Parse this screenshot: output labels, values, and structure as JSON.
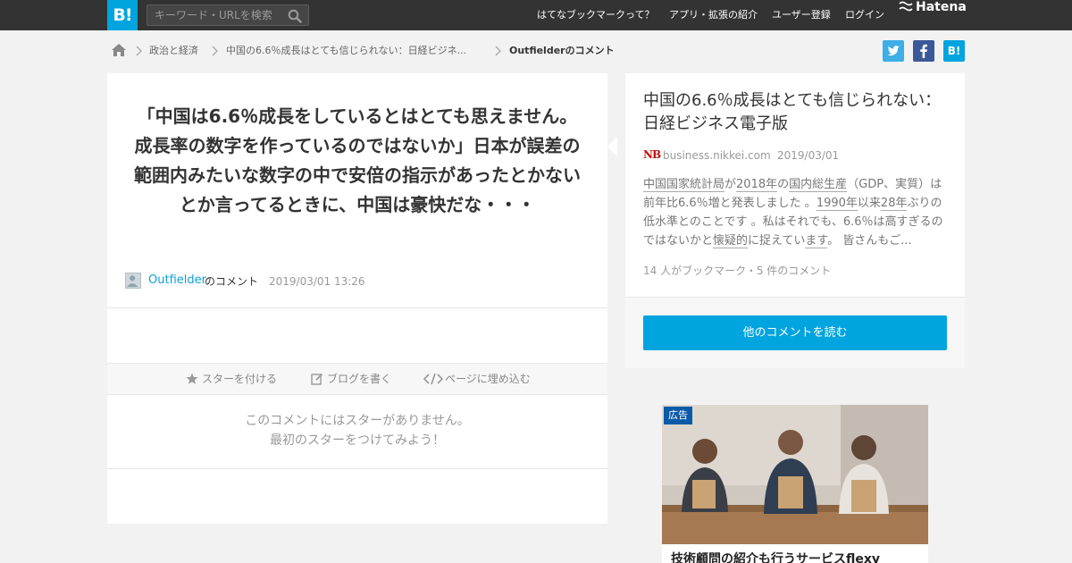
{
  "header": {
    "logo": "B!",
    "search_placeholder": "キーワード・URLを検索",
    "nav": [
      "はてなブックマークって？",
      "アプリ・拡張の紹介",
      "ユーザー登録",
      "ログイン"
    ],
    "brand": "Hatena"
  },
  "breadcrumb": {
    "items": [
      "政治と経済",
      "中国の6.6％成長はとても信じられない：日経ビジネ...",
      "Outfielderのコメント"
    ]
  },
  "share": {
    "twitter": "twitter-icon",
    "facebook": "facebook-icon",
    "hatena": "B!"
  },
  "comment": {
    "text": "「中国は6.6％成長をしているとはとても思えません。成長率の数字を作っているのではないか」日本が誤差の範囲内みたいな数字の中で安倍の指示があったとかないとか言ってるときに、中国は豪快だな・・・",
    "author": "Outfielder",
    "author_suffix": "のコメント",
    "date": "2019/03/01 13:26"
  },
  "actions": {
    "star": "スターを付ける",
    "blog": "ブログを書く",
    "embed": "ページに埋め込む"
  },
  "stars": {
    "empty_line1": "このコメントにはスターがありません。",
    "empty_line2": "最初のスターをつけてみよう！"
  },
  "entry": {
    "title": "中国の6.6％成長はとても信じられない：日経ビジネス電子版",
    "source_logo": "NB",
    "domain": "business.nikkei.com",
    "date": "2019/03/01",
    "summary_parts": [
      {
        "t": "中国国家統計局",
        "u": true
      },
      {
        "t": "が",
        "u": false
      },
      {
        "t": "2018年",
        "u": true
      },
      {
        "t": "の",
        "u": false
      },
      {
        "t": "国内総生産",
        "u": true
      },
      {
        "t": "（GDP、実質）は前年比6.6％増と発表しました 。",
        "u": false
      },
      {
        "t": "1990年",
        "u": true
      },
      {
        "t": "以来",
        "u": false
      },
      {
        "t": "28年",
        "u": true
      },
      {
        "t": "ぶりの低水準とのことです 。私はそれでも、6.6％は高すぎるのではないかと",
        "u": false
      },
      {
        "t": "懐疑的",
        "u": true
      },
      {
        "t": "に捉えてい",
        "u": false
      },
      {
        "t": "ます",
        "u": true
      },
      {
        "t": "。 皆さんもご...",
        "u": false
      }
    ],
    "bookmark_count": "14 人がブックマーク・5 件のコメント",
    "read_button": "他のコメントを読む"
  },
  "ad": {
    "badge": "広告",
    "title": "技術顧問の紹介も行うサービスflexy"
  },
  "colors": {
    "header_bg": "#333333",
    "accent": "#00a4de",
    "link": "#0da0d8",
    "page_bg": "#f2f2f2"
  }
}
